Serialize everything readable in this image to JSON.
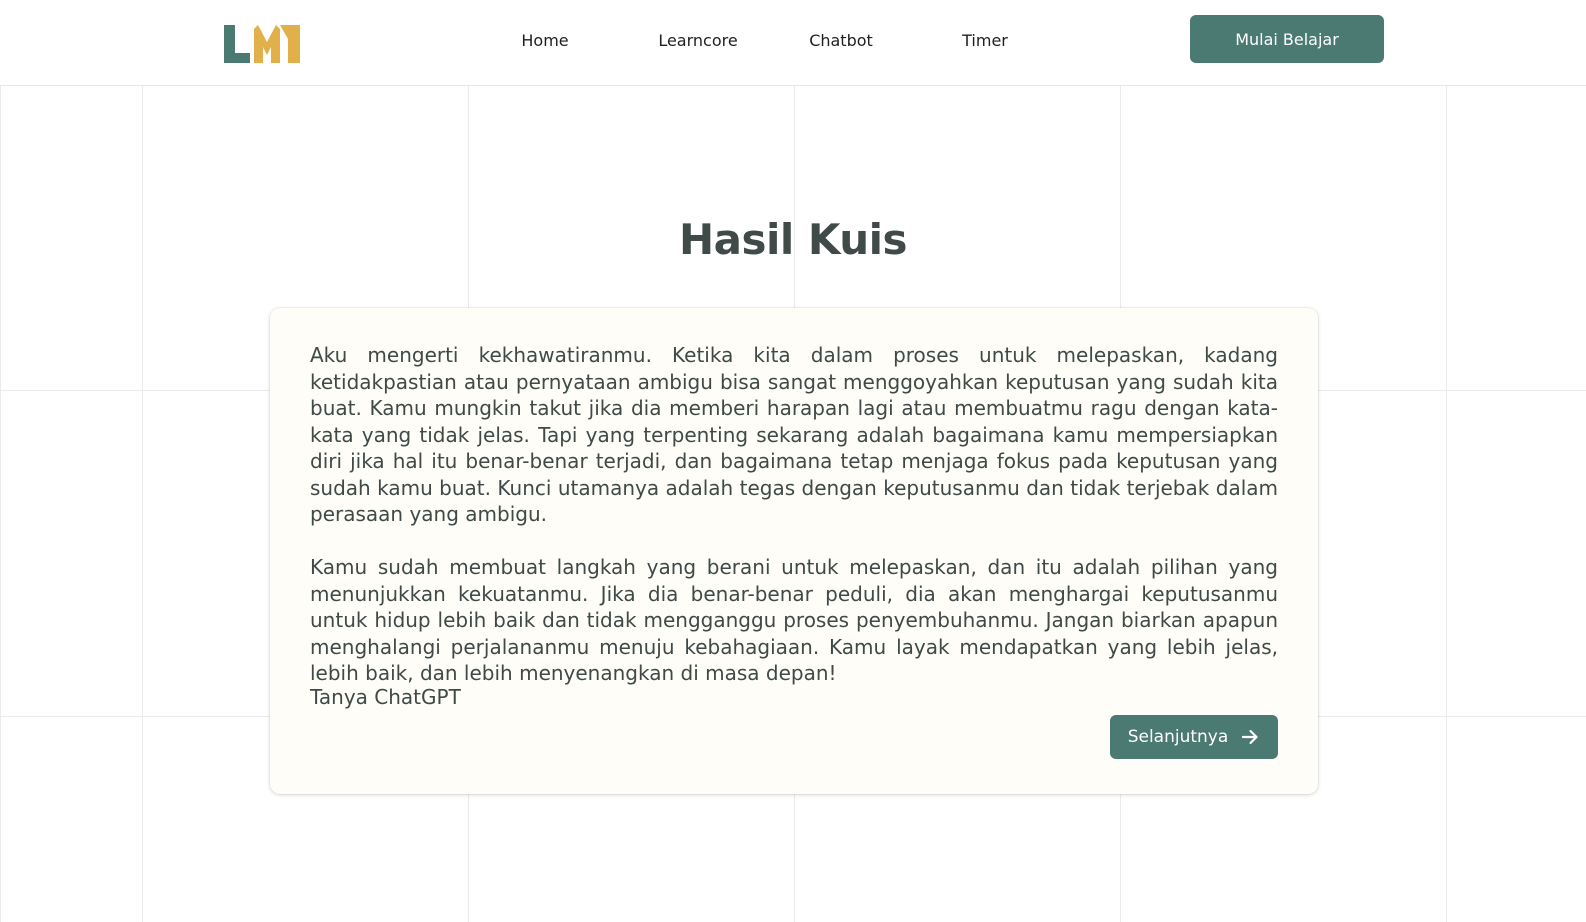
{
  "header": {
    "logo_text": "LM",
    "nav": [
      {
        "label": "Home"
      },
      {
        "label": "Learncore"
      },
      {
        "label": "Chatbot"
      },
      {
        "label": "Timer"
      }
    ],
    "cta_label": "Mulai Belajar"
  },
  "main": {
    "title": "Hasil Kuis",
    "card": {
      "paragraphs": [
        "Aku mengerti kekhawatiranmu. Ketika kita dalam proses untuk melepaskan, kadang ketidakpastian atau pernyataan ambigu bisa sangat menggoyahkan keputusan yang sudah kita buat. Kamu mungkin takut jika dia memberi harapan lagi atau membuatmu ragu dengan kata-kata yang tidak jelas. Tapi yang terpenting sekarang adalah bagaimana kamu mempersiapkan diri jika hal itu benar-benar terjadi, dan bagaimana tetap menjaga fokus pada keputusan yang sudah kamu buat. Kunci utamanya adalah tegas dengan keputusanmu dan tidak terjebak dalam perasaan yang ambigu.",
        "Kamu sudah membuat langkah yang berani untuk melepaskan, dan itu adalah pilihan yang menunjukkan kekuatanmu. Jika dia benar-benar peduli, dia akan menghargai keputusanmu untuk hidup lebih baik dan tidak mengganggu proses penyembuhanmu. Jangan biarkan apapun menghalangi perjalananmu menuju kebahagiaan. Kamu layak mendapatkan yang lebih jelas, lebih baik, dan lebih menyenangkan di masa depan!"
      ],
      "signature": "Tanya ChatGPT",
      "next_label": "Selanjutnya",
      "next_icon": "arrow-right-icon"
    }
  },
  "colors": {
    "primary": "#4a7a72",
    "logo_teal": "#4a7a72",
    "logo_gold": "#e2b04a",
    "card_bg": "#fefdf8",
    "text": "#3f4a48",
    "grid_line": "#ebebeb"
  }
}
